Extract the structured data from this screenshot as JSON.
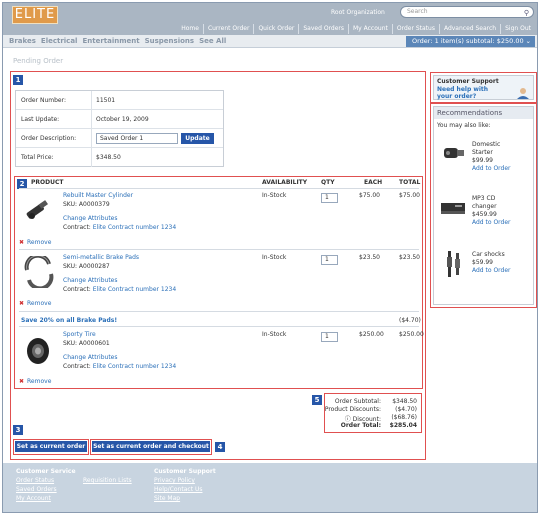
{
  "header": {
    "logo": "ELITE",
    "org_link": "Root Organization",
    "search_placeholder": "Search",
    "nav": [
      "Home",
      "Current Order",
      "Quick Order",
      "Saved Orders",
      "My Account",
      "Order Status",
      "Advanced Search",
      "Sign Out"
    ]
  },
  "categories": [
    "Brakes",
    "Electrical",
    "Entertainment",
    "Suspensions",
    "See All"
  ],
  "cart_summary": "Order: 1 item(s) subtotal: $250.00",
  "page_title": "Pending Order",
  "annotations": [
    "1",
    "2",
    "3",
    "4",
    "5",
    "6",
    "7"
  ],
  "order_info": {
    "number_label": "Order Number:",
    "number": "11501",
    "updated_label": "Last Update:",
    "updated": "October 19, 2009",
    "desc_label": "Order Description:",
    "desc": "Saved Order 1",
    "update_button": "Update",
    "total_label": "Total Price:",
    "total": "$348.50"
  },
  "table_headers": [
    "PRODUCT",
    "AVAILABILITY",
    "QTY",
    "EACH",
    "TOTAL"
  ],
  "items": [
    {
      "name": "Rebuilt Master Cylinder",
      "sku": "SKU: A0000379",
      "change": "Change Attributes",
      "contract_label": "Contract:",
      "contract": "Elite Contract number 1234",
      "avail": "In-Stock",
      "qty": "1",
      "each": "$75.00",
      "total": "$75.00",
      "remove": "Remove"
    },
    {
      "name": "Semi-metallic Brake Pads",
      "sku": "SKU: A0000287",
      "change": "Change Attributes",
      "contract_label": "Contract:",
      "contract": "Elite Contract number 1234",
      "avail": "In-Stock",
      "qty": "1",
      "each": "$23.50",
      "total": "$23.50",
      "remove": "Remove"
    },
    {
      "name": "Sporty Tire",
      "sku": "SKU: A0000601",
      "change": "Change Attributes",
      "contract_label": "Contract:",
      "contract": "Elite Contract number 1234",
      "avail": "In-Stock",
      "qty": "1",
      "each": "$250.00",
      "total": "$250.00",
      "remove": "Remove"
    }
  ],
  "promo": {
    "text": "Save 20% on all Brake Pads!",
    "amount": "($4.70)"
  },
  "summary": [
    {
      "label": "Order Subtotal:",
      "value": "$348.50"
    },
    {
      "label": "Product Discounts:",
      "value": "($4.70)"
    },
    {
      "label": "Discount:",
      "value": "($68.76)"
    },
    {
      "label": "Order Total:",
      "value": "$285.04"
    }
  ],
  "buttons": {
    "set_current": "Set as current order",
    "set_checkout": "Set as current order and checkout"
  },
  "support": {
    "title": "Customer Support",
    "sub1": "Need help with",
    "sub2": "your order?"
  },
  "recommendations": {
    "title": "Recommendations",
    "subtitle": "You may also like:",
    "items": [
      {
        "name1": "Domestic",
        "name2": "Starter",
        "price": "$99.99",
        "add": "Add to Order"
      },
      {
        "name1": "MP3 CD",
        "name2": "changer",
        "price": "$459.99",
        "add": "Add to Order"
      },
      {
        "name1": "Car shocks",
        "name2": "",
        "price": "$59.99",
        "add": "Add to Order"
      }
    ]
  },
  "footer": {
    "service_title": "Customer Service",
    "service_links": [
      "Order Status",
      "Saved Orders",
      "My Account"
    ],
    "req_link": "Requisition Lists",
    "support_title": "Customer Support",
    "support_links": [
      "Privacy Policy",
      "Help/Contact Us",
      "Site Map"
    ]
  }
}
